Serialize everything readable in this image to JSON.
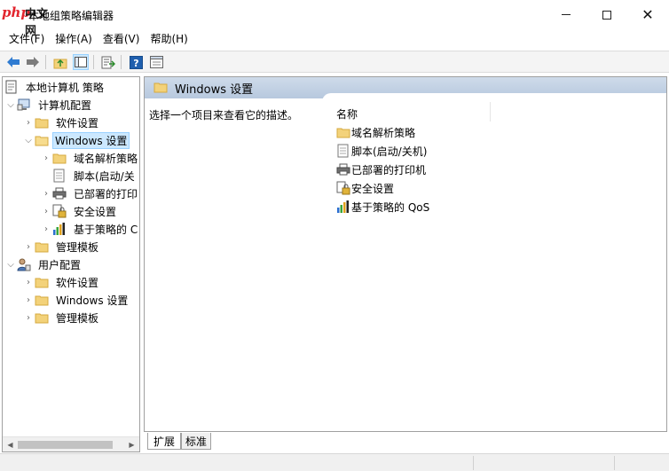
{
  "window": {
    "title": "本地组策略编辑器",
    "watermark_php": "php",
    "watermark_cn": "中文网"
  },
  "menu": [
    {
      "label": "文件(F)"
    },
    {
      "label": "操作(A)"
    },
    {
      "label": "查看(V)"
    },
    {
      "label": "帮助(H)"
    }
  ],
  "tree": {
    "root": "本地计算机 策略",
    "computer_config": "计算机配置",
    "software_settings": "软件设置",
    "windows_settings": "Windows 设置",
    "dns_policy": "域名解析策略",
    "scripts": "脚本(启动/关",
    "printers": "已部署的打印",
    "security_settings": "安全设置",
    "qos": "基于策略的 C",
    "admin_templates": "管理模板",
    "user_config": "用户配置",
    "user_software_settings": "软件设置",
    "user_windows_settings": "Windows 设置",
    "user_admin_templates": "管理模板"
  },
  "right_pane": {
    "header": "Windows 设置",
    "description": "选择一个项目来查看它的描述。",
    "column_name": "名称",
    "items": [
      {
        "label": "域名解析策略",
        "icon": "folder-icon"
      },
      {
        "label": "脚本(启动/关机)",
        "icon": "script-icon"
      },
      {
        "label": "已部署的打印机",
        "icon": "printer-icon"
      },
      {
        "label": "安全设置",
        "icon": "security-icon"
      },
      {
        "label": "基于策略的 QoS",
        "icon": "qos-chart-icon"
      }
    ]
  },
  "tabs": {
    "extended": "扩展",
    "standard": "标准"
  },
  "colors": {
    "folder": "#f3d27a",
    "folder_border": "#d6a93f",
    "selection": "#cce8ff",
    "arrow_blue": "#2f7bd1",
    "header_gradient": "#c4d3e6"
  }
}
